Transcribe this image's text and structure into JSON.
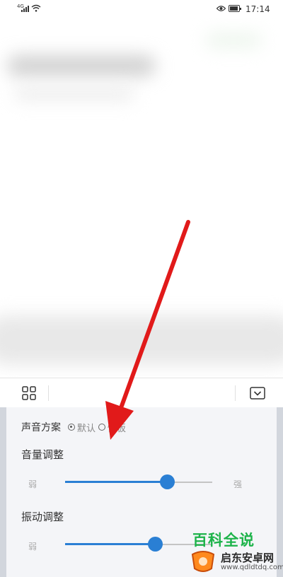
{
  "status_bar": {
    "signal_label": "4G",
    "time": "17:14",
    "icons": [
      "signal-icon",
      "wifi-icon",
      "eye-icon",
      "battery-icon"
    ]
  },
  "toolbar": {
    "icons": [
      "grid-icon",
      "collapse-icon"
    ]
  },
  "sound_panel": {
    "scheme_label": "声音方案",
    "scheme_options": [
      {
        "label": "默认",
        "selected": true
      },
      {
        "label": "快板",
        "selected": false
      }
    ],
    "volume": {
      "title": "音量调整",
      "min_label": "弱",
      "max_label": "强",
      "level": 0.69
    },
    "vibration": {
      "title": "振动调整",
      "min_label": "弱",
      "level": 0.61
    }
  },
  "watermark": {
    "text": "百科全说",
    "site_name": "启东安卓网",
    "url": "www.qdldtdq.com"
  },
  "colors": {
    "accent": "#2a7fd4",
    "arrow": "#e11a1a",
    "watermark_green": "#1db34a"
  }
}
